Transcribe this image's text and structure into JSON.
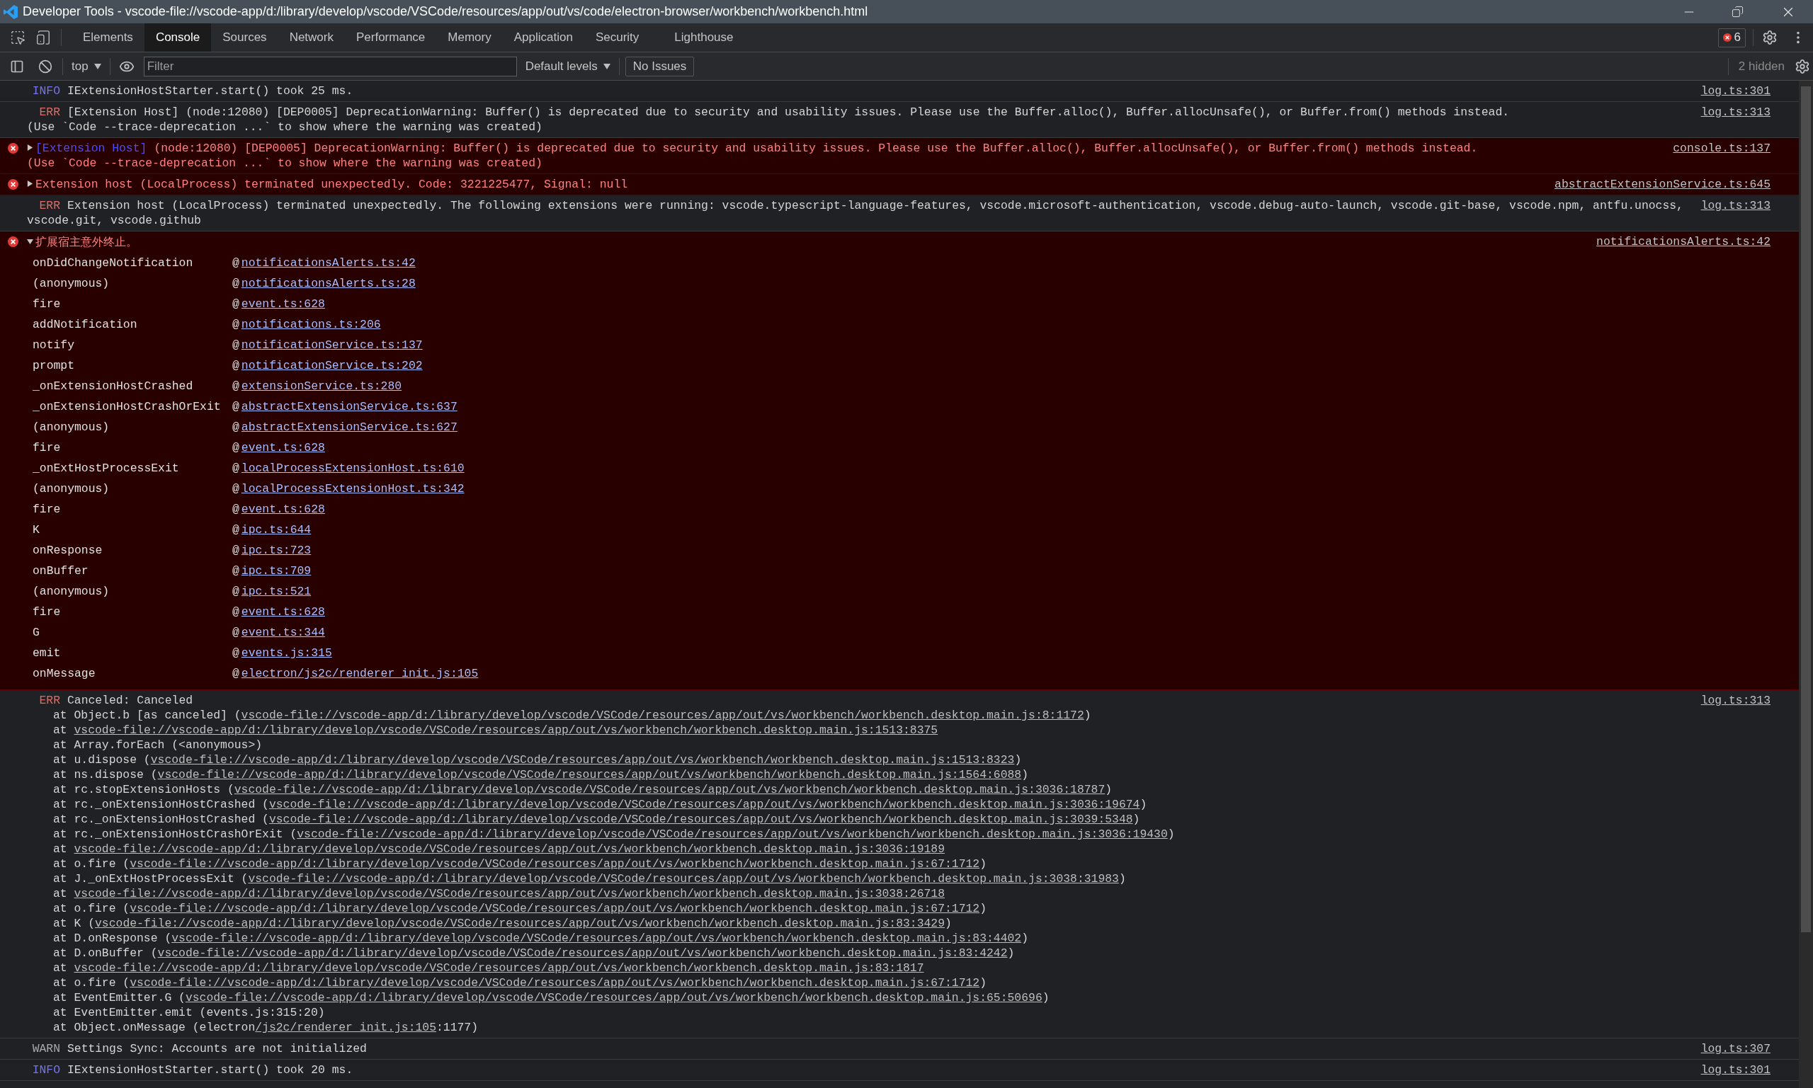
{
  "window": {
    "title": "Developer Tools - vscode-file://vscode-app/d:/library/develop/vscode/VSCode/resources/app/out/vs/code/electron-browser/workbench/workbench.html"
  },
  "tabs": [
    {
      "label": "Elements",
      "selected": false
    },
    {
      "label": "Console",
      "selected": true
    },
    {
      "label": "Sources",
      "selected": false
    },
    {
      "label": "Network",
      "selected": false
    },
    {
      "label": "Performance",
      "selected": false
    },
    {
      "label": "Memory",
      "selected": false
    },
    {
      "label": "Application",
      "selected": false
    },
    {
      "label": "Security",
      "selected": false
    },
    {
      "label": "Lighthouse",
      "selected": false
    }
  ],
  "error_badge": {
    "count": "6"
  },
  "toolbar": {
    "context": "top",
    "filter": {
      "placeholder": "Filter"
    },
    "levels": "Default levels",
    "issues": "No Issues",
    "hidden": "2 hidden"
  },
  "console": [
    {
      "kind": "log",
      "level": "INFO",
      "message": "IExtensionHostStarter.start() took 25 ms.",
      "source": "log.ts:301"
    },
    {
      "kind": "log",
      "level": "ERR",
      "message": "[Extension Host] (node:12080) [DEP0005] DeprecationWarning: Buffer() is deprecated due to security and usability issues. Please use the Buffer.alloc(), Buffer.allocUnsafe(), or Buffer.from() methods instead.\n(Use `Code --trace-deprecation ...` to show where the warning was created)",
      "source": "log.ts:313"
    },
    {
      "kind": "error",
      "expanded": false,
      "tag": "[Extension Host]",
      "message": "(node:12080) [DEP0005] DeprecationWarning: Buffer() is deprecated due to security and usability issues. Please use the Buffer.alloc(), Buffer.allocUnsafe(), or Buffer.from() methods instead.\n(Use `Code --trace-deprecation ...` to show where the warning was created)",
      "source": "console.ts:137"
    },
    {
      "kind": "error",
      "expanded": false,
      "message": "Extension host (LocalProcess) terminated unexpectedly. Code: 3221225477, Signal: null",
      "source": "abstractExtensionService.ts:645"
    },
    {
      "kind": "log",
      "level": "ERR",
      "message": "Extension host (LocalProcess) terminated unexpectedly. The following extensions were running: vscode.typescript-language-features, vscode.microsoft-authentication, vscode.debug-auto-launch, vscode.git-base, vscode.npm, antfu.unocss,\nvscode.git, vscode.github",
      "source": "log.ts:313"
    },
    {
      "kind": "error",
      "expanded": true,
      "message": "扩展宿主意外终止。",
      "source": "notificationsAlerts.ts:42",
      "frames": [
        {
          "function": "onDidChangeNotification",
          "separator": "@",
          "location": "notificationsAlerts.ts:42"
        },
        {
          "function": "(anonymous)",
          "separator": "@",
          "location": "notificationsAlerts.ts:28"
        },
        {
          "function": "fire",
          "separator": "@",
          "location": "event.ts:628"
        },
        {
          "function": "addNotification",
          "separator": "@",
          "location": "notifications.ts:206"
        },
        {
          "function": "notify",
          "separator": "@",
          "location": "notificationService.ts:137"
        },
        {
          "function": "prompt",
          "separator": "@",
          "location": "notificationService.ts:202"
        },
        {
          "function": "_onExtensionHostCrashed",
          "separator": "@",
          "location": "extensionService.ts:280"
        },
        {
          "function": "_onExtensionHostCrashOrExit",
          "separator": "@",
          "location": "abstractExtensionService.ts:637"
        },
        {
          "function": "(anonymous)",
          "separator": "@",
          "location": "abstractExtensionService.ts:627"
        },
        {
          "function": "fire",
          "separator": "@",
          "location": "event.ts:628"
        },
        {
          "function": "_onExtHostProcessExit",
          "separator": "@",
          "location": "localProcessExtensionHost.ts:610"
        },
        {
          "function": "(anonymous)",
          "separator": "@",
          "location": "localProcessExtensionHost.ts:342"
        },
        {
          "function": "fire",
          "separator": "@",
          "location": "event.ts:628"
        },
        {
          "function": "K",
          "separator": "@",
          "location": "ipc.ts:644"
        },
        {
          "function": "onResponse",
          "separator": "@",
          "location": "ipc.ts:723"
        },
        {
          "function": "onBuffer",
          "separator": "@",
          "location": "ipc.ts:709"
        },
        {
          "function": "(anonymous)",
          "separator": "@",
          "location": "ipc.ts:521"
        },
        {
          "function": "fire",
          "separator": "@",
          "location": "event.ts:628"
        },
        {
          "function": "G",
          "separator": "@",
          "location": "event.ts:344"
        },
        {
          "function": "emit",
          "separator": "@",
          "location": "events.js:315"
        },
        {
          "function": "onMessage",
          "separator": "@",
          "location": "electron/js2c/renderer_init.js:105"
        }
      ]
    },
    {
      "kind": "log",
      "level": "ERR",
      "message": "Canceled: Canceled",
      "source": "log.ts:313",
      "trace": [
        {
          "prefix": "at Object.b [as canceled] (",
          "link": "vscode-file://vscode-app/d:/library/develop/vscode/VSCode/resources/app/out/vs/workbench/workbench.desktop.main.js:8:1172",
          "suffix": ")"
        },
        {
          "prefix": "at ",
          "link": "vscode-file://vscode-app/d:/library/develop/vscode/VSCode/resources/app/out/vs/workbench/workbench.desktop.main.js:1513:8375"
        },
        {
          "prefix": "at Array.forEach (<anonymous>)"
        },
        {
          "prefix": "at u.dispose (",
          "link": "vscode-file://vscode-app/d:/library/develop/vscode/VSCode/resources/app/out/vs/workbench/workbench.desktop.main.js:1513:8323",
          "suffix": ")"
        },
        {
          "prefix": "at ns.dispose (",
          "link": "vscode-file://vscode-app/d:/library/develop/vscode/VSCode/resources/app/out/vs/workbench/workbench.desktop.main.js:1564:6088",
          "suffix": ")"
        },
        {
          "prefix": "at rc.stopExtensionHosts (",
          "link": "vscode-file://vscode-app/d:/library/develop/vscode/VSCode/resources/app/out/vs/workbench/workbench.desktop.main.js:3036:18787",
          "suffix": ")"
        },
        {
          "prefix": "at rc._onExtensionHostCrashed (",
          "link": "vscode-file://vscode-app/d:/library/develop/vscode/VSCode/resources/app/out/vs/workbench/workbench.desktop.main.js:3036:19674",
          "suffix": ")"
        },
        {
          "prefix": "at rc._onExtensionHostCrashed (",
          "link": "vscode-file://vscode-app/d:/library/develop/vscode/VSCode/resources/app/out/vs/workbench/workbench.desktop.main.js:3039:5348",
          "suffix": ")"
        },
        {
          "prefix": "at rc._onExtensionHostCrashOrExit (",
          "link": "vscode-file://vscode-app/d:/library/develop/vscode/VSCode/resources/app/out/vs/workbench/workbench.desktop.main.js:3036:19430",
          "suffix": ")"
        },
        {
          "prefix": "at ",
          "link": "vscode-file://vscode-app/d:/library/develop/vscode/VSCode/resources/app/out/vs/workbench/workbench.desktop.main.js:3036:19189"
        },
        {
          "prefix": "at o.fire (",
          "link": "vscode-file://vscode-app/d:/library/develop/vscode/VSCode/resources/app/out/vs/workbench/workbench.desktop.main.js:67:1712",
          "suffix": ")"
        },
        {
          "prefix": "at J._onExtHostProcessExit (",
          "link": "vscode-file://vscode-app/d:/library/develop/vscode/VSCode/resources/app/out/vs/workbench/workbench.desktop.main.js:3038:31983",
          "suffix": ")"
        },
        {
          "prefix": "at ",
          "link": "vscode-file://vscode-app/d:/library/develop/vscode/VSCode/resources/app/out/vs/workbench/workbench.desktop.main.js:3038:26718"
        },
        {
          "prefix": "at o.fire (",
          "link": "vscode-file://vscode-app/d:/library/develop/vscode/VSCode/resources/app/out/vs/workbench/workbench.desktop.main.js:67:1712",
          "suffix": ")"
        },
        {
          "prefix": "at K (",
          "link": "vscode-file://vscode-app/d:/library/develop/vscode/VSCode/resources/app/out/vs/workbench/workbench.desktop.main.js:83:3429",
          "suffix": ")"
        },
        {
          "prefix": "at D.onResponse (",
          "link": "vscode-file://vscode-app/d:/library/develop/vscode/VSCode/resources/app/out/vs/workbench/workbench.desktop.main.js:83:4402",
          "suffix": ")"
        },
        {
          "prefix": "at D.onBuffer (",
          "link": "vscode-file://vscode-app/d:/library/develop/vscode/VSCode/resources/app/out/vs/workbench/workbench.desktop.main.js:83:4242",
          "suffix": ")"
        },
        {
          "prefix": "at ",
          "link": "vscode-file://vscode-app/d:/library/develop/vscode/VSCode/resources/app/out/vs/workbench/workbench.desktop.main.js:83:1817"
        },
        {
          "prefix": "at o.fire (",
          "link": "vscode-file://vscode-app/d:/library/develop/vscode/VSCode/resources/app/out/vs/workbench/workbench.desktop.main.js:67:1712",
          "suffix": ")"
        },
        {
          "prefix": "at EventEmitter.G (",
          "link": "vscode-file://vscode-app/d:/library/develop/vscode/VSCode/resources/app/out/vs/workbench/workbench.desktop.main.js:65:50696",
          "suffix": ")"
        },
        {
          "prefix": "at EventEmitter.emit (events.js:315:20)"
        },
        {
          "prefix": "at Object.onMessage (electron",
          "link": "/js2c/renderer_init.js:105",
          "suffix": ":1177)"
        }
      ]
    },
    {
      "kind": "log",
      "level": "WARN",
      "message": "Settings Sync: Accounts are not initialized",
      "source": "log.ts:307"
    },
    {
      "kind": "log",
      "level": "INFO",
      "message": "IExtensionHostStarter.start() took 20 ms.",
      "source": "log.ts:301"
    }
  ]
}
